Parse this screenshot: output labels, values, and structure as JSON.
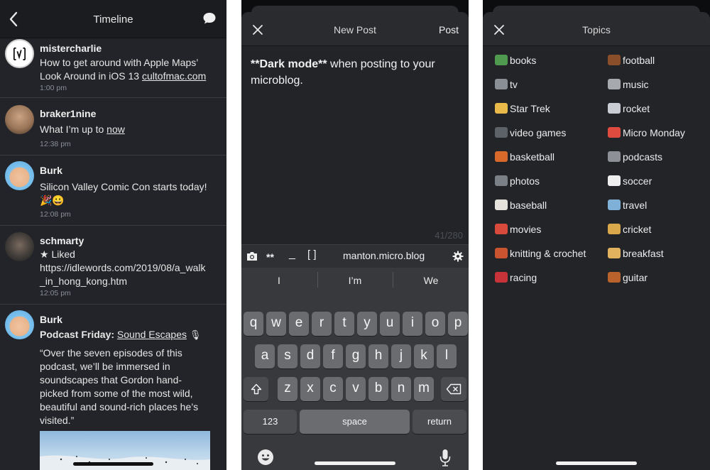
{
  "timeline": {
    "title": "Timeline",
    "posts": [
      {
        "user": "mistercharlie",
        "text": "How to get around with Apple Maps’ Look Around in iOS 13 ",
        "link": "cultofmac.com",
        "time": "1:00 pm"
      },
      {
        "user": "braker1nine",
        "text": "What I’m up to ",
        "link": "now",
        "time": "12:38 pm"
      },
      {
        "user": "Burk",
        "text": "Silicon Valley Comic Con starts today! 🎉😀",
        "time": "12:08 pm"
      },
      {
        "user": "schmarty",
        "liked": "★ Liked",
        "text": "https://idlewords.com/2019/08/a_walk_in_hong_kong.htm",
        "time": "12:05 pm"
      },
      {
        "user": "Burk",
        "bold": "Podcast Friday:",
        "link": "Sound Escapes",
        "mic": "🎙",
        "text": "“Over the seven episodes of this podcast, we’ll be immersed in soundscapes that Gordon hand-picked from some of the most wild, beautiful and sound-rich places he’s visited.”"
      }
    ]
  },
  "new_post": {
    "title": "New Post",
    "post_label": "Post",
    "draft_bold": "**Dark mode**",
    "draft_rest": " when posting to your microblog.",
    "counter_used": "41",
    "counter_total": "/280",
    "toolbar": {
      "bold": "**",
      "italic": "_",
      "link": "[ ]",
      "site": "manton.micro.blog"
    },
    "suggestions": [
      "I",
      "I’m",
      "We"
    ],
    "keys": {
      "row1": [
        "q",
        "w",
        "e",
        "r",
        "t",
        "y",
        "u",
        "i",
        "o",
        "p"
      ],
      "row2": [
        "a",
        "s",
        "d",
        "f",
        "g",
        "h",
        "j",
        "k",
        "l"
      ],
      "row3": [
        "z",
        "x",
        "c",
        "v",
        "b",
        "n",
        "m"
      ],
      "numbers": "123",
      "space": "space",
      "return": "return"
    }
  },
  "topics": {
    "title": "Topics",
    "left": [
      {
        "label": "books",
        "icon": "books-icon",
        "color": "#4f9a4f"
      },
      {
        "label": "tv",
        "icon": "tv-icon",
        "color": "#8a8f96"
      },
      {
        "label": "Star Trek",
        "icon": "vulcan-salute-icon",
        "color": "#e9b94a"
      },
      {
        "label": "video games",
        "icon": "game-controller-icon",
        "color": "#5d6168"
      },
      {
        "label": "basketball",
        "icon": "basketball-icon",
        "color": "#d9692b"
      },
      {
        "label": "photos",
        "icon": "camera-icon",
        "color": "#7b7f86"
      },
      {
        "label": "baseball",
        "icon": "baseball-icon",
        "color": "#e6e2dc"
      },
      {
        "label": "movies",
        "icon": "popcorn-icon",
        "color": "#d84b3c"
      },
      {
        "label": "knitting & crochet",
        "icon": "yarn-icon",
        "color": "#c9542f"
      },
      {
        "label": "racing",
        "icon": "race-car-icon",
        "color": "#c8333a"
      }
    ],
    "right": [
      {
        "label": "football",
        "icon": "football-icon",
        "color": "#8a4e2a"
      },
      {
        "label": "music",
        "icon": "music-note-icon",
        "color": "#a6a9ae"
      },
      {
        "label": "rocket",
        "icon": "rocket-icon",
        "color": "#c9cdd3"
      },
      {
        "label": "Micro Monday",
        "icon": "calendar-icon",
        "color": "#e04b3f"
      },
      {
        "label": "podcasts",
        "icon": "microphone-icon",
        "color": "#8d9197"
      },
      {
        "label": "soccer",
        "icon": "soccer-ball-icon",
        "color": "#eeeeee"
      },
      {
        "label": "travel",
        "icon": "map-icon",
        "color": "#7fb0d8"
      },
      {
        "label": "cricket",
        "icon": "cricket-bat-icon",
        "color": "#d8a84a"
      },
      {
        "label": "breakfast",
        "icon": "pancakes-icon",
        "color": "#e3b25e"
      },
      {
        "label": "guitar",
        "icon": "guitar-icon",
        "color": "#b9622c"
      }
    ]
  }
}
